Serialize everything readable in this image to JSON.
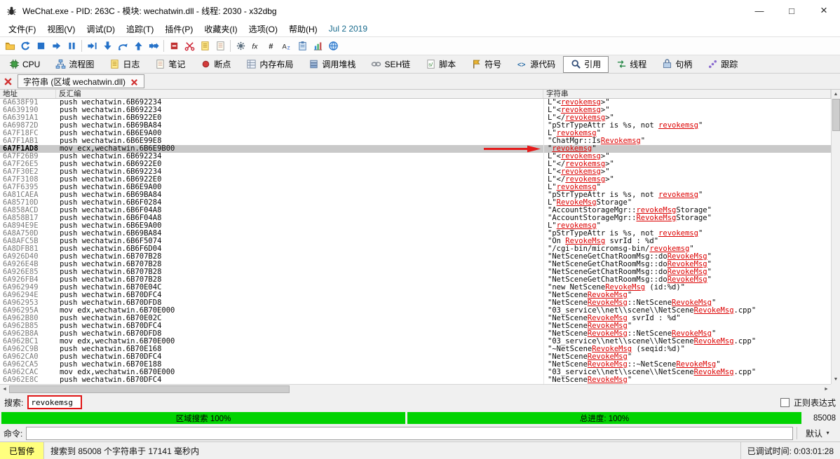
{
  "window": {
    "title": "WeChat.exe - PID: 263C - 模块: wechatwin.dll - 线程: 2030 - x32dbg",
    "controls": {
      "minimize": "—",
      "maximize": "□",
      "close": "×"
    }
  },
  "menu": {
    "items": [
      "文件(F)",
      "视图(V)",
      "调试(D)",
      "追踪(T)",
      "插件(P)",
      "收藏夹(I)",
      "选项(O)",
      "帮助(H)"
    ],
    "build_date": "Jul 2 2019"
  },
  "toolbar": {
    "items": [
      {
        "name": "open-file",
        "icon": "folder"
      },
      {
        "name": "restart",
        "icon": "restart"
      },
      {
        "name": "stop",
        "icon": "stop"
      },
      {
        "name": "run",
        "icon": "run"
      },
      {
        "name": "pause",
        "icon": "pause"
      },
      {
        "sep": true
      },
      {
        "name": "run-to-user-code",
        "icon": "run-to"
      },
      {
        "name": "step-into",
        "icon": "step-into"
      },
      {
        "name": "step-over",
        "icon": "step-over"
      },
      {
        "name": "step-out",
        "icon": "step-out"
      },
      {
        "name": "animate",
        "icon": "animate"
      },
      {
        "sep": true
      },
      {
        "name": "breakpoint",
        "icon": "red-square"
      },
      {
        "name": "trace-record",
        "icon": "scissors"
      },
      {
        "name": "log-window",
        "icon": "page-yellow"
      },
      {
        "name": "notes-window",
        "icon": "page"
      },
      {
        "sep": true
      },
      {
        "name": "settings",
        "icon": "gear"
      },
      {
        "name": "function-analysis",
        "icon": "fx"
      },
      {
        "name": "hash-analysis",
        "icon": "hash"
      },
      {
        "name": "string-analysis",
        "icon": "az"
      },
      {
        "name": "memory-layout",
        "icon": "clipboard"
      },
      {
        "name": "statistics",
        "icon": "chart"
      },
      {
        "name": "online-help",
        "icon": "globe"
      }
    ]
  },
  "tabs": {
    "selected": "引用",
    "items": [
      {
        "id": "cpu",
        "label": "CPU",
        "icon": "chip"
      },
      {
        "id": "graph",
        "label": "流程图",
        "icon": "flow"
      },
      {
        "id": "log",
        "label": "日志",
        "icon": "page-yellow"
      },
      {
        "id": "notes",
        "label": "笔记",
        "icon": "page"
      },
      {
        "id": "breakpoints",
        "label": "断点",
        "icon": "dot"
      },
      {
        "id": "memory-map",
        "label": "内存布局",
        "icon": "memmap"
      },
      {
        "id": "call-stack",
        "label": "调用堆栈",
        "icon": "stack"
      },
      {
        "id": "seh",
        "label": "SEH链",
        "icon": "chain"
      },
      {
        "id": "script",
        "label": "脚本",
        "icon": "script"
      },
      {
        "id": "symbols",
        "label": "符号",
        "icon": "flag"
      },
      {
        "id": "source",
        "label": "源代码",
        "icon": "source"
      },
      {
        "id": "references",
        "label": "引用",
        "icon": "magnifier"
      },
      {
        "id": "threads",
        "label": "线程",
        "icon": "threads"
      },
      {
        "id": "handles",
        "label": "句柄",
        "icon": "handle"
      },
      {
        "id": "trace",
        "label": "跟踪",
        "icon": "trace"
      }
    ]
  },
  "doc_tabs": {
    "items": [
      {
        "label": "字符串 (区域 wechatwin.dll)"
      }
    ]
  },
  "table": {
    "columns": [
      "地址",
      "反汇编",
      "字符串"
    ],
    "selected_row": 6,
    "rows": [
      {
        "addr": "6A638F91",
        "disasm": "push wechatwin.6B692234",
        "str": "L\"<revokemsg>\""
      },
      {
        "addr": "6A639190",
        "disasm": "push wechatwin.6B692234",
        "str": "L\"<revokemsg>\""
      },
      {
        "addr": "6A6391A1",
        "disasm": "push wechatwin.6B6922E0",
        "str": "L\"</revokemsg>\""
      },
      {
        "addr": "6A69872D",
        "disasm": "push wechatwin.6B69BA84",
        "str": "\"pStrTypeAttr is %s, not revokemsg\""
      },
      {
        "addr": "6A7F18FC",
        "disasm": "push wechatwin.6B6E9A00",
        "str": "L\"revokemsg\""
      },
      {
        "addr": "6A7F1AB1",
        "disasm": "push wechatwin.6B6E99E8",
        "str": "\"ChatMgr::IsRevokemsg\""
      },
      {
        "addr": "6A7F1AD8",
        "disasm": "mov ecx,wechatwin.6B6E9B00",
        "str": "\"revokemsg\""
      },
      {
        "addr": "6A7F26B9",
        "disasm": "push wechatwin.6B692234",
        "str": "L\"<revokemsg>\""
      },
      {
        "addr": "6A7F26E5",
        "disasm": "push wechatwin.6B6922E0",
        "str": "L\"</revokemsg>\""
      },
      {
        "addr": "6A7F30E2",
        "disasm": "push wechatwin.6B692234",
        "str": "L\"<revokemsg>\""
      },
      {
        "addr": "6A7F3108",
        "disasm": "push wechatwin.6B6922E0",
        "str": "L\"</revokemsg>\""
      },
      {
        "addr": "6A7F6395",
        "disasm": "push wechatwin.6B6E9A00",
        "str": "L\"revokemsg\""
      },
      {
        "addr": "6A81CAEA",
        "disasm": "push wechatwin.6B69BA84",
        "str": "\"pStrTypeAttr is %s, not revokemsg\""
      },
      {
        "addr": "6A85710D",
        "disasm": "push wechatwin.6B6F0284",
        "str": "L\"RevokeMsgStorage\""
      },
      {
        "addr": "6A858ACD",
        "disasm": "push wechatwin.6B6F04A8",
        "str": "\"AccountStorageMgr::revokeMsgStorage\""
      },
      {
        "addr": "6A858B17",
        "disasm": "push wechatwin.6B6F04A8",
        "str": "\"AccountStorageMgr::RevokeMsgStorage\""
      },
      {
        "addr": "6A894E9E",
        "disasm": "push wechatwin.6B6E9A00",
        "str": "L\"revokemsg\""
      },
      {
        "addr": "6A8A750D",
        "disasm": "push wechatwin.6B69BA84",
        "str": "\"pStrTypeAttr is %s, not revokemsg\""
      },
      {
        "addr": "6A8AFC5B",
        "disasm": "push wechatwin.6B6F5074",
        "str": "\"On RevokeMsg svrId : %d\""
      },
      {
        "addr": "6A8DFB81",
        "disasm": "push wechatwin.6B6F6D04",
        "str": "\"/cgi-bin/micromsg-bin/revokemsg\""
      },
      {
        "addr": "6A926D40",
        "disasm": "push wechatwin.6B707B28",
        "str": "\"NetSceneGetChatRoomMsg::doRevokeMsg\""
      },
      {
        "addr": "6A926E4B",
        "disasm": "push wechatwin.6B707B28",
        "str": "\"NetSceneGetChatRoomMsg::doRevokeMsg\""
      },
      {
        "addr": "6A926E85",
        "disasm": "push wechatwin.6B707B28",
        "str": "\"NetSceneGetChatRoomMsg::doRevokeMsg\""
      },
      {
        "addr": "6A926FB4",
        "disasm": "push wechatwin.6B707B28",
        "str": "\"NetSceneGetChatRoomMsg::doRevokeMsg\""
      },
      {
        "addr": "6A962949",
        "disasm": "push wechatwin.6B70E04C",
        "str": "\"new NetSceneRevokeMsg (id:%d)\""
      },
      {
        "addr": "6A96294E",
        "disasm": "push wechatwin.6B70DFC4",
        "str": "\"NetSceneRevokeMsg\""
      },
      {
        "addr": "6A962953",
        "disasm": "push wechatwin.6B70DFD8",
        "str": "\"NetSceneRevokeMsg::NetSceneRevokeMsg\""
      },
      {
        "addr": "6A96295A",
        "disasm": "mov edx,wechatwin.6B70E000",
        "str": "\"03_service\\\\net\\\\scene\\\\NetSceneRevokeMsg.cpp\""
      },
      {
        "addr": "6A962B80",
        "disasm": "push wechatwin.6B70E02C",
        "str": "\"NetSceneRevokeMsg svrId : %d\""
      },
      {
        "addr": "6A962B85",
        "disasm": "push wechatwin.6B70DFC4",
        "str": "\"NetSceneRevokeMsg\""
      },
      {
        "addr": "6A962B8A",
        "disasm": "push wechatwin.6B70DFD8",
        "str": "\"NetSceneRevokeMsg::NetSceneRevokeMsg\""
      },
      {
        "addr": "6A962BC1",
        "disasm": "mov edx,wechatwin.6B70E000",
        "str": "\"03_service\\\\net\\\\scene\\\\NetSceneRevokeMsg.cpp\""
      },
      {
        "addr": "6A962C9B",
        "disasm": "push wechatwin.6B70E168",
        "str": "\"~NetSceneRevokeMsg (seqid:%d)\""
      },
      {
        "addr": "6A962CA0",
        "disasm": "push wechatwin.6B70DFC4",
        "str": "\"NetSceneRevokeMsg\""
      },
      {
        "addr": "6A962CA5",
        "disasm": "push wechatwin.6B70E188",
        "str": "\"NetSceneRevokeMsg::~NetSceneRevokeMsg\""
      },
      {
        "addr": "6A962CAC",
        "disasm": "mov edx,wechatwin.6B70E000",
        "str": "\"03_service\\\\net\\\\scene\\\\NetSceneRevokeMsg.cpp\""
      },
      {
        "addr": "6A962E8C",
        "disasm": "push wechatwin.6B70DFC4",
        "str": "\"NetSceneRevokeMsg\""
      }
    ]
  },
  "search": {
    "label": "搜索:",
    "value": "revokemsg",
    "regex_label": "正则表达式",
    "regex_checked": false
  },
  "progress": {
    "region_label": "区域搜索 100%",
    "total_label": "总进度: 100%",
    "region_pct": 100,
    "total_pct": 100,
    "count": "85008",
    "bar_color": "#00d300"
  },
  "command": {
    "label": "命令:",
    "value": "",
    "profile": "默认"
  },
  "status": {
    "state": "已暂停",
    "message": "搜索到 85008 个字符串于 17141 毫秒内",
    "time_label": "已调试时间: 0:03:01:28"
  },
  "colors": {
    "accent_green": "#00d300",
    "match_red": "#dc0000",
    "selection_gray": "#c9c9c9",
    "paused_yellow": "#ffff7e",
    "annotation_red": "#e51c1c"
  }
}
